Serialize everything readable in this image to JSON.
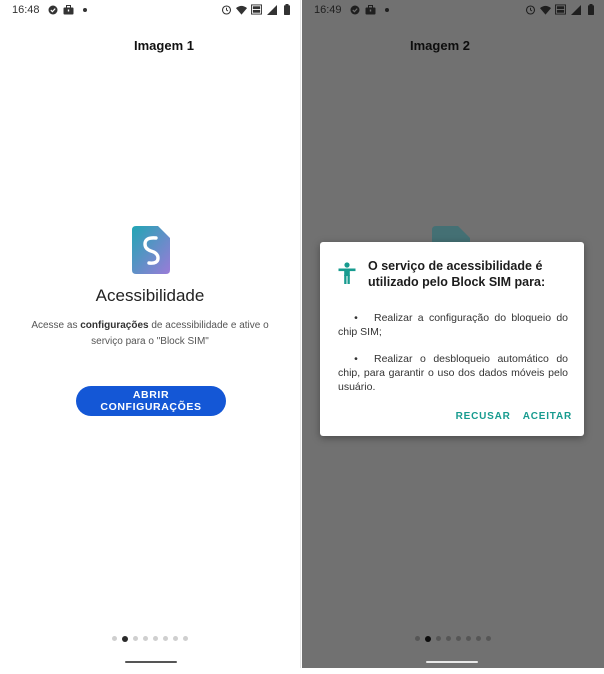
{
  "screen1": {
    "status_time": "16:48",
    "label": "Imagem 1",
    "title": "Acessibilidade",
    "desc_before": "Acesse as ",
    "desc_bold": "configurações",
    "desc_after": " de acessibilidade e ative o serviço para o \"Block SIM\"",
    "open_button": "ABRIR CONFIGURAÇÕES",
    "pager_count": 8,
    "pager_active_index": 1
  },
  "screen2": {
    "status_time": "16:49",
    "label": "Imagem 2",
    "dialog": {
      "title": "O serviço de acessibilidade é utilizado pelo Block SIM para:",
      "items": [
        "Realizar a configuração do bloqueio do chip SIM;",
        "Realizar o desbloqueio automático do chip, para garantir o uso dos dados móveis pelo usuário."
      ],
      "bullet": "•",
      "decline": "RECUSAR",
      "accept": "ACEITAR"
    },
    "pager_count": 8,
    "pager_active_index": 1
  },
  "colors": {
    "primary_button": "#1457d6",
    "dialog_action": "#179b8f",
    "dim_overlay": "#717171"
  },
  "icons": [
    "clock-check-icon",
    "briefcase-icon",
    "alarm-icon",
    "wifi-icon",
    "data-icon",
    "signal-icon",
    "battery-icon",
    "accessibility-icon",
    "block-sim-logo"
  ]
}
